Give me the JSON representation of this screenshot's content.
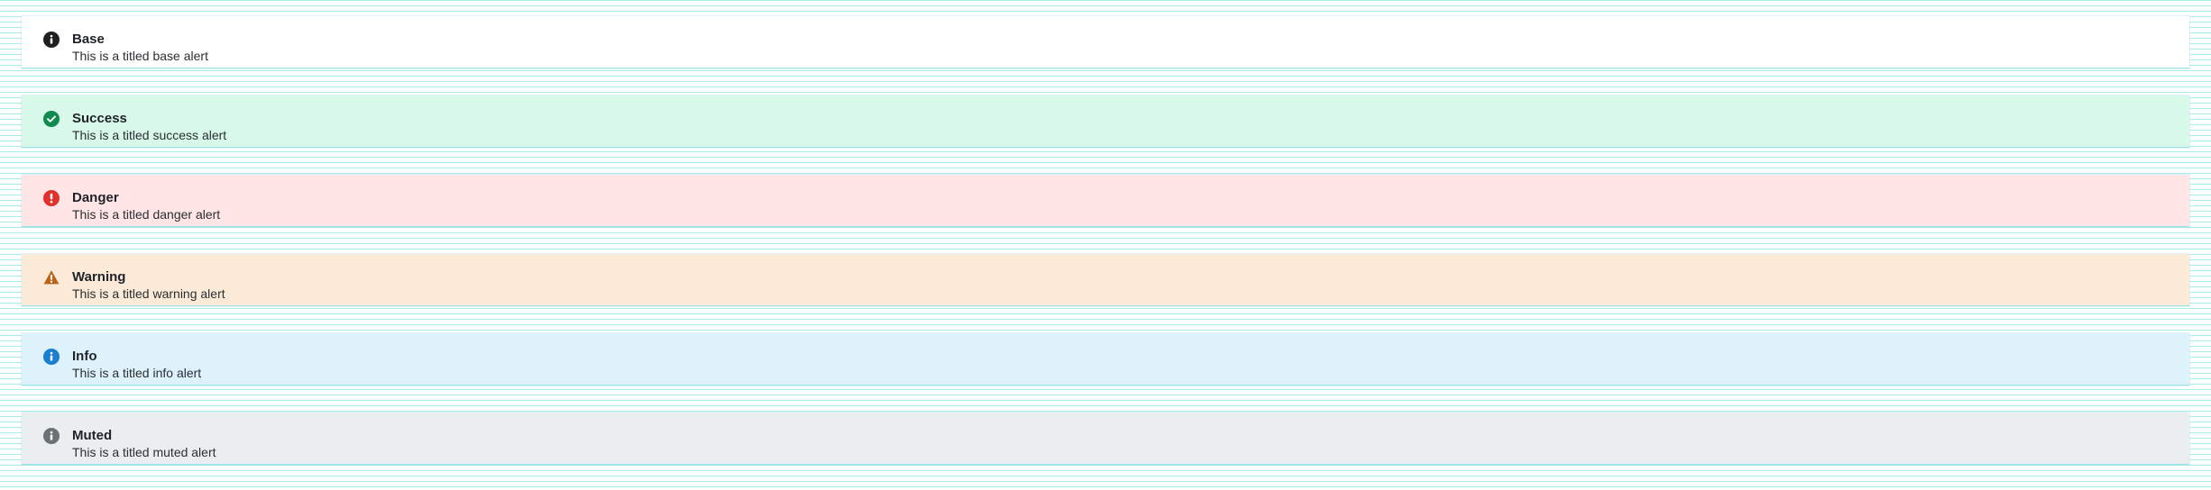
{
  "alerts": [
    {
      "variant": "base",
      "icon": "info-icon",
      "title": "Base",
      "message": "This is a titled base alert",
      "background": "#ffffff",
      "icon_color": "#1f1f1f"
    },
    {
      "variant": "success",
      "icon": "check-circle-icon",
      "title": "Success",
      "message": "This is a titled success alert",
      "background": "#d8f8ea",
      "icon_color": "#118a4f"
    },
    {
      "variant": "danger",
      "icon": "exclamation-circle-icon",
      "title": "Danger",
      "message": "This is a titled danger alert",
      "background": "#ffe5e6",
      "icon_color": "#e0322c"
    },
    {
      "variant": "warning",
      "icon": "warning-triangle-icon",
      "title": "Warning",
      "message": "This is a titled warning alert",
      "background": "#faead7",
      "icon_color": "#b8641a"
    },
    {
      "variant": "info",
      "icon": "info-icon",
      "title": "Info",
      "message": "This is a titled info alert",
      "background": "#def2fc",
      "icon_color": "#1a7fd0"
    },
    {
      "variant": "muted",
      "icon": "info-icon",
      "title": "Muted",
      "message": "This is a titled muted alert",
      "background": "#eaeef1",
      "icon_color": "#6b7176"
    }
  ]
}
